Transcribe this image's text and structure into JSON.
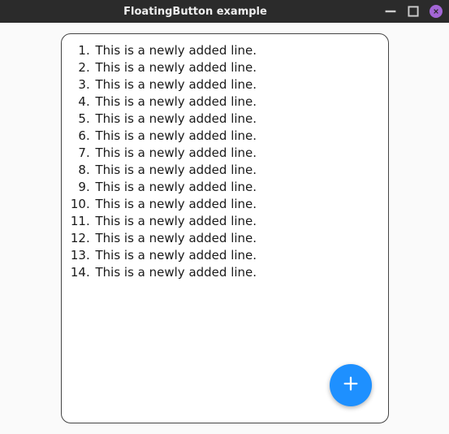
{
  "window": {
    "title": "FloatingButton example"
  },
  "list": {
    "items": [
      "This is a newly added line.",
      "This is a newly added line.",
      "This is a newly added line.",
      "This is a newly added line.",
      "This is a newly added line.",
      "This is a newly added line.",
      "This is a newly added line.",
      "This is a newly added line.",
      "This is a newly added line.",
      "This is a newly added line.",
      "This is a newly added line.",
      "This is a newly added line.",
      "This is a newly added line.",
      "This is a newly added line."
    ]
  },
  "fab": {
    "icon": "plus-icon"
  }
}
